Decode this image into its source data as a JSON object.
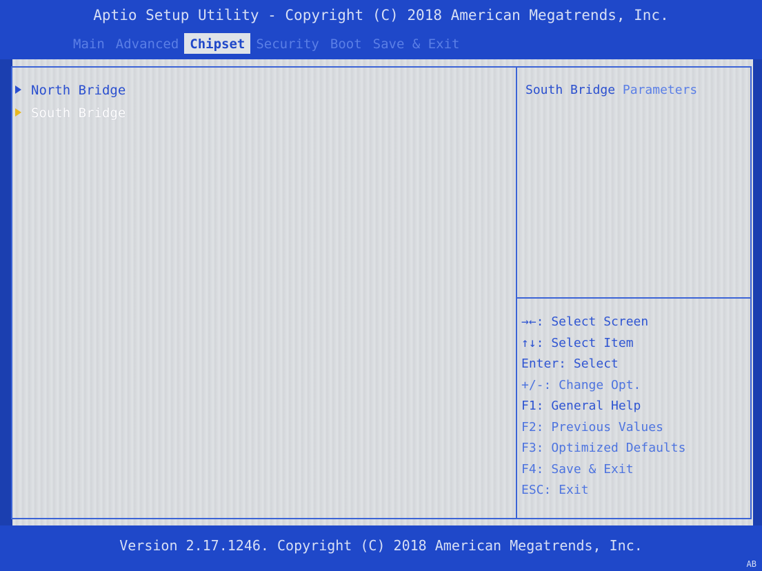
{
  "header": {
    "title": "Aptio Setup Utility - Copyright (C) 2018 American Megatrends, Inc.",
    "tabs": [
      {
        "label": "Main"
      },
      {
        "label": "Advanced"
      },
      {
        "label": "Chipset"
      },
      {
        "label": "Security"
      },
      {
        "label": "Boot"
      },
      {
        "label": "Save & Exit"
      }
    ],
    "active_tab": "Chipset"
  },
  "menu": {
    "items": [
      {
        "label": "North Bridge"
      },
      {
        "label": "South Bridge"
      }
    ],
    "selected": "South Bridge"
  },
  "help": {
    "part1": "South Bridge",
    "part2": "Parameters"
  },
  "keys": [
    {
      "text": "→←: Select Screen"
    },
    {
      "text": "↑↓: Select Item"
    },
    {
      "text": "Enter: Select"
    },
    {
      "text": "+/-: Change Opt."
    },
    {
      "text": "F1: General Help"
    },
    {
      "text": "F2: Previous Values"
    },
    {
      "text": "F3: Optimized Defaults"
    },
    {
      "text": "F4: Save & Exit"
    },
    {
      "text": "ESC: Exit"
    }
  ],
  "footer": {
    "version": "Version 2.17.1246. Copyright (C) 2018 American Megatrends, Inc.",
    "code": "AB"
  },
  "colors": {
    "bios_blue": "#1f48c9",
    "panel_grey": "#d9dce0",
    "item_blue": "#2a4fcf",
    "selected_arrow": "#e8b820"
  }
}
